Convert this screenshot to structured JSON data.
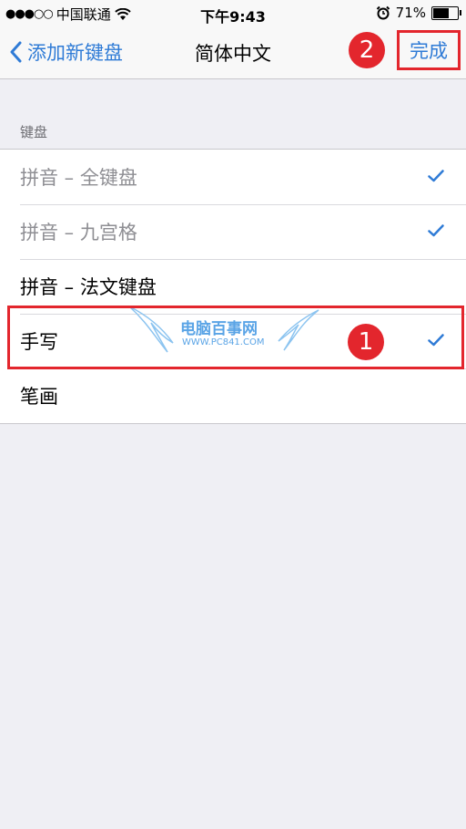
{
  "statusbar": {
    "signal": "●●●○○",
    "carrier": "中国联通",
    "time": "下午9:43",
    "battery": "71%",
    "battery_level": 0.71
  },
  "nav": {
    "back_label": "添加新键盘",
    "title": "简体中文",
    "done_label": "完成"
  },
  "section": {
    "header": "键盘"
  },
  "rows": [
    {
      "label": "拼音 – 全键盘",
      "checked": true
    },
    {
      "label": "拼音 – 九宫格",
      "checked": true
    },
    {
      "label": "拼音 – 法文键盘",
      "checked": false
    },
    {
      "label": "手写",
      "checked": true
    },
    {
      "label": "笔画",
      "checked": false
    }
  ],
  "annotations": {
    "badge_1": "1",
    "badge_2": "2"
  },
  "watermark": {
    "text": "电脑百事网",
    "url": "WWW.PC841.COM"
  },
  "colors": {
    "accent": "#2f7bd6",
    "annotation": "#e3262d",
    "background": "#efeff4"
  }
}
